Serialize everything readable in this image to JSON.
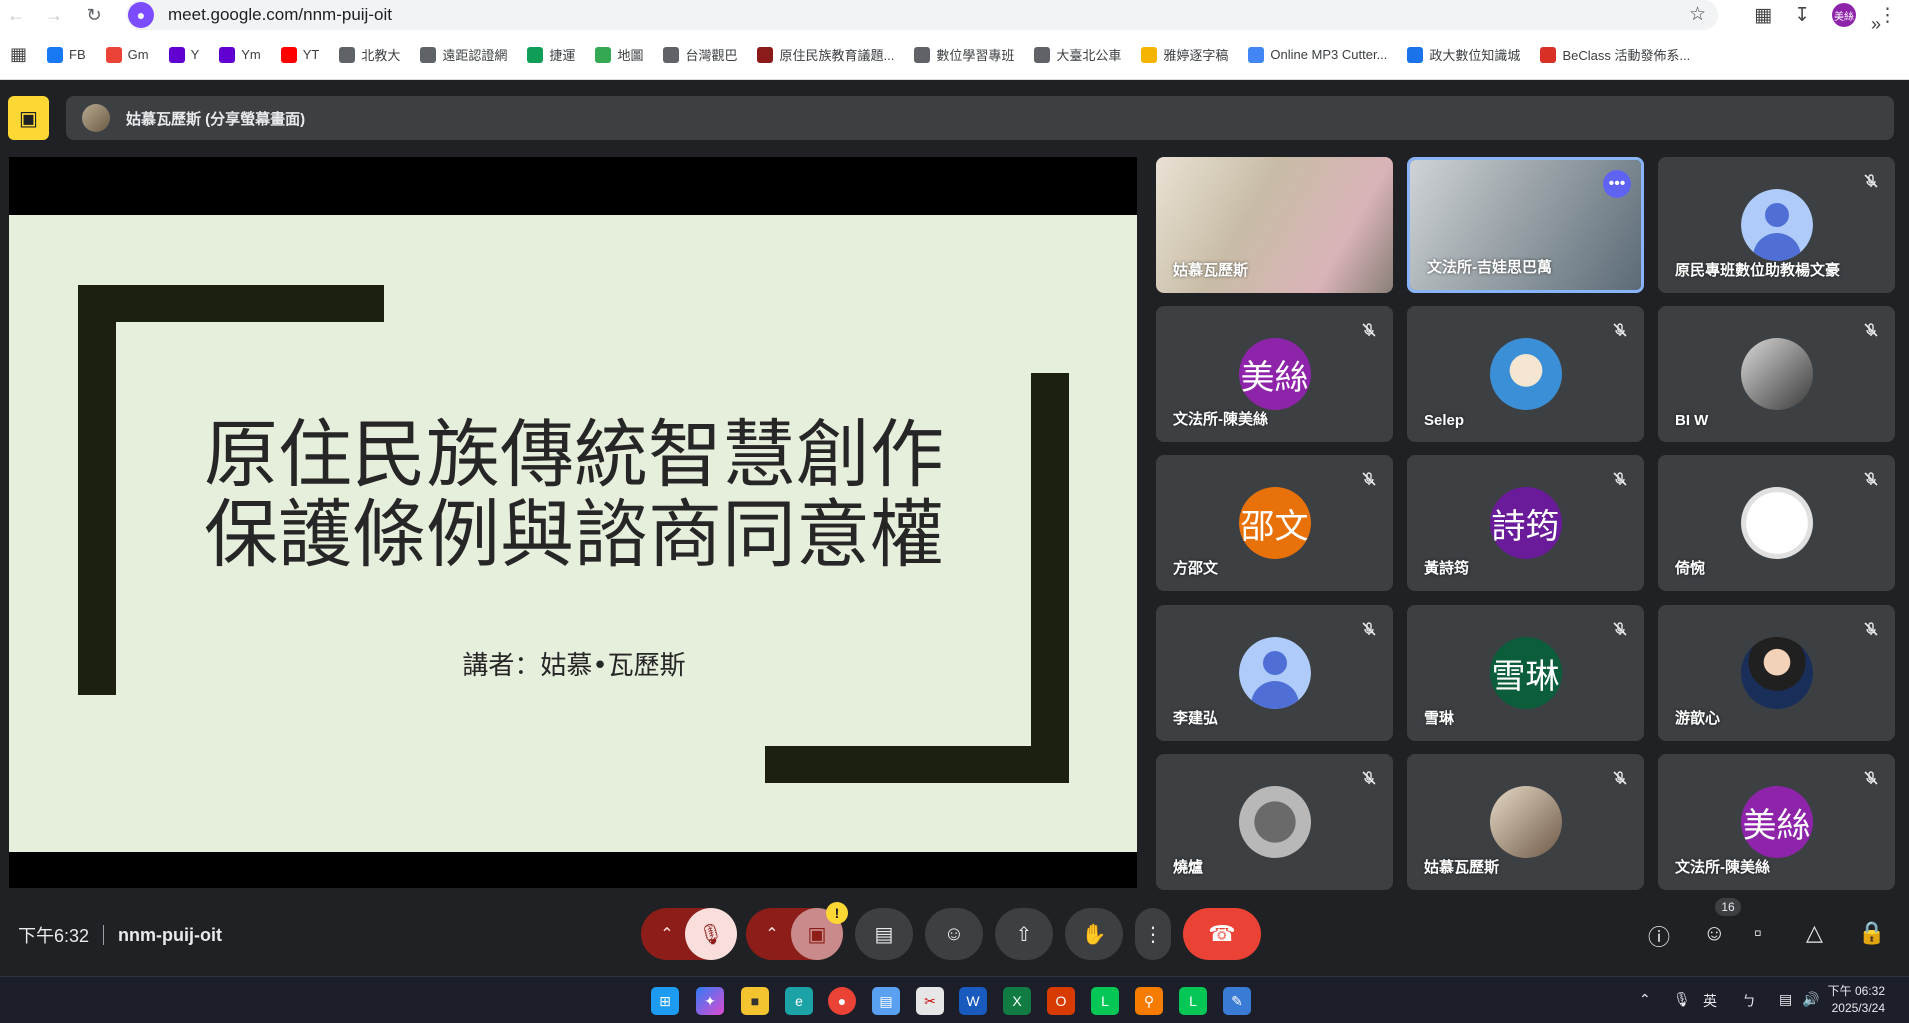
{
  "browser": {
    "url": "meet.google.com/nnm-puij-oit",
    "profile_initials": "美絲"
  },
  "bookmarks": [
    {
      "label": "FB",
      "icon": "facebook-icon",
      "color": "#1877f2"
    },
    {
      "label": "Gm",
      "icon": "gmail-icon",
      "color": "#ea4335"
    },
    {
      "label": "Y",
      "icon": "yahoo-icon",
      "color": "#6001d2"
    },
    {
      "label": "Ym",
      "icon": "yahoo-mail-icon",
      "color": "#6001d2"
    },
    {
      "label": "YT",
      "icon": "youtube-icon",
      "color": "#ff0000"
    },
    {
      "label": "北教大",
      "icon": "folder-icon",
      "color": "#5f6368"
    },
    {
      "label": "遠距認證網",
      "icon": "globe-icon",
      "color": "#5f6368"
    },
    {
      "label": "捷運",
      "icon": "metro-icon",
      "color": "#0f9d58"
    },
    {
      "label": "地圖",
      "icon": "maps-icon",
      "color": "#34a853"
    },
    {
      "label": "台灣觀巴",
      "icon": "globe-icon",
      "color": "#5f6368"
    },
    {
      "label": "原住民族教育議題...",
      "icon": "emblem-icon",
      "color": "#8b1a1a"
    },
    {
      "label": "數位學習專班",
      "icon": "folder-icon",
      "color": "#5f6368"
    },
    {
      "label": "大臺北公車",
      "icon": "globe-icon",
      "color": "#5f6368"
    },
    {
      "label": "雅婷逐字稿",
      "icon": "yating-icon",
      "color": "#f4b400"
    },
    {
      "label": "Online MP3 Cutter...",
      "icon": "mp3-cutter-icon",
      "color": "#4285f4"
    },
    {
      "label": "政大數位知識城",
      "icon": "nccu-icon",
      "color": "#1a73e8"
    },
    {
      "label": "BeClass 活動發佈系...",
      "icon": "beclass-icon",
      "color": "#d93025"
    }
  ],
  "meet": {
    "presenter_text": "姑慕瓦歷斯 (分享螢幕畫面)",
    "slide": {
      "title_line1": "原住民族傳統智慧創作",
      "title_line2": "保護條例與諮商同意權",
      "speaker": "講者：姑慕•瓦歷斯"
    },
    "participants": [
      {
        "name": "姑慕瓦歷斯",
        "type": "video",
        "muted": false
      },
      {
        "name": "文法所-吉娃思巴萬",
        "type": "video",
        "muted": false,
        "active": true
      },
      {
        "name": "原民專班數位助教楊文豪",
        "type": "default",
        "muted": true
      },
      {
        "name": "文法所-陳美絲",
        "type": "initials",
        "initials": "美絲",
        "color": "#8e24aa",
        "muted": true
      },
      {
        "name": "Selep",
        "type": "photo",
        "muted": true
      },
      {
        "name": "BI W",
        "type": "photo",
        "muted": true
      },
      {
        "name": "方邵文",
        "type": "initials",
        "initials": "邵文",
        "color": "#e8710a",
        "muted": true
      },
      {
        "name": "黃詩筠",
        "type": "initials",
        "initials": "詩筠",
        "color": "#6a1b9a",
        "muted": true
      },
      {
        "name": "倚惋",
        "type": "photo",
        "muted": true
      },
      {
        "name": "李建弘",
        "type": "default",
        "muted": true
      },
      {
        "name": "雪琳",
        "type": "initials",
        "initials": "雪琳",
        "color": "#0b5d3b",
        "muted": true
      },
      {
        "name": "游歆心",
        "type": "photo",
        "muted": true
      },
      {
        "name": "燒爐",
        "type": "photo",
        "muted": true
      },
      {
        "name": "姑慕瓦歷斯",
        "type": "photo",
        "muted": true
      },
      {
        "name": "文法所-陳美絲",
        "type": "initials",
        "initials": "美絲",
        "color": "#8e24aa",
        "muted": true
      }
    ],
    "time": "下午6:32",
    "meeting_code": "nnm-puij-oit",
    "participant_count": "16",
    "camera_warning": "!"
  },
  "taskbar": {
    "ime_lang": "英",
    "ime_mode": "ㄅ",
    "clock_time": "下午 06:32",
    "clock_date": "2025/3/24"
  }
}
